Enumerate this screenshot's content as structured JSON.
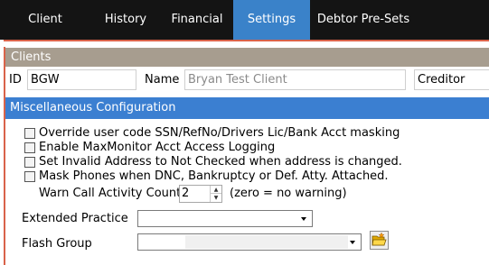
{
  "tabs": [
    {
      "label": "Client",
      "active": false
    },
    {
      "label": "History",
      "active": false
    },
    {
      "label": "Financial",
      "active": false
    },
    {
      "label": "Settings",
      "active": true
    },
    {
      "label": "Debtor Pre-Sets",
      "active": false
    }
  ],
  "colors": {
    "tabbar_bg": "#141414",
    "active_tab": "#3a82c9",
    "clients_header": "#a79d8f",
    "misc_header": "#3b7fd1",
    "frame_border": "#d9634a"
  },
  "clients": {
    "header": "Clients",
    "id_label": "ID",
    "id_value": "BGW",
    "name_label": "Name",
    "name_value": "Bryan Test Client",
    "type_value": "Creditor"
  },
  "misc": {
    "header": "Miscellaneous Configuration",
    "checkboxes": [
      {
        "label": "Override user code SSN/RefNo/Drivers Lic/Bank Acct masking",
        "checked": false
      },
      {
        "label": "Enable MaxMonitor Acct Access Logging",
        "checked": false
      },
      {
        "label": "Set Invalid Address to Not Checked when address is changed.",
        "checked": false
      },
      {
        "label": "Mask Phones when DNC, Bankruptcy or Def. Atty. Attached.",
        "checked": false
      }
    ],
    "warn_call_label": "Warn Call Activity Count",
    "warn_call_value": "2",
    "warn_call_hint": "(zero = no warning)",
    "extended_practice_label": "Extended Practice",
    "extended_practice_value": "",
    "flash_group_label": "Flash Group",
    "flash_group_value": ""
  },
  "icons": {
    "folder_button": "folder-open-icon",
    "spinner_up": "spin-up-icon",
    "spinner_down": "spin-down-icon",
    "dropdown": "chevron-down-icon"
  }
}
